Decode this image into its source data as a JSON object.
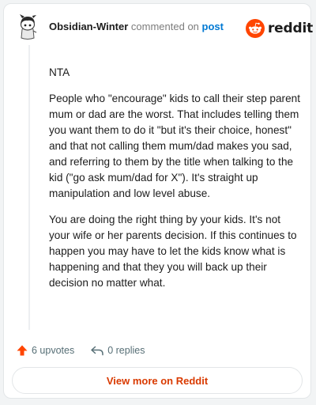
{
  "comment": {
    "username": "Obsidian-Winter",
    "action_text": "commented on",
    "post_link_label": "post",
    "paragraphs": [
      "NTA",
      "People who \"encourage\" kids to call their step parent mum or dad are the worst. That includes telling them you want them to do it \"but it's their choice, honest\" and that not calling them mum/dad makes you sad, and referring to them by the title when talking to the kid (\"go ask mum/dad for X\"). It's straight up manipulation and low level abuse.",
      "You are doing the right thing by your kids. It's not your wife or her parents decision. If this continues to happen you may have to let the kids know what is happening and that they you will back up their decision no matter what."
    ]
  },
  "brand": {
    "wordmark": "reddit",
    "color": "#ff4500"
  },
  "footer": {
    "upvotes_label": "6 upvotes",
    "replies_label": "0 replies"
  },
  "actions": {
    "view_more_label": "View more on Reddit"
  },
  "icons": {
    "avatar": "snoo-avatar-icon",
    "logo": "reddit-logo-icon",
    "upvote": "upvote-arrow-icon",
    "reply": "reply-arrow-icon"
  },
  "colors": {
    "upvote": "#ff4500",
    "link": "#0079d3",
    "view_more": "#d93a00",
    "muted": "#576f76"
  }
}
